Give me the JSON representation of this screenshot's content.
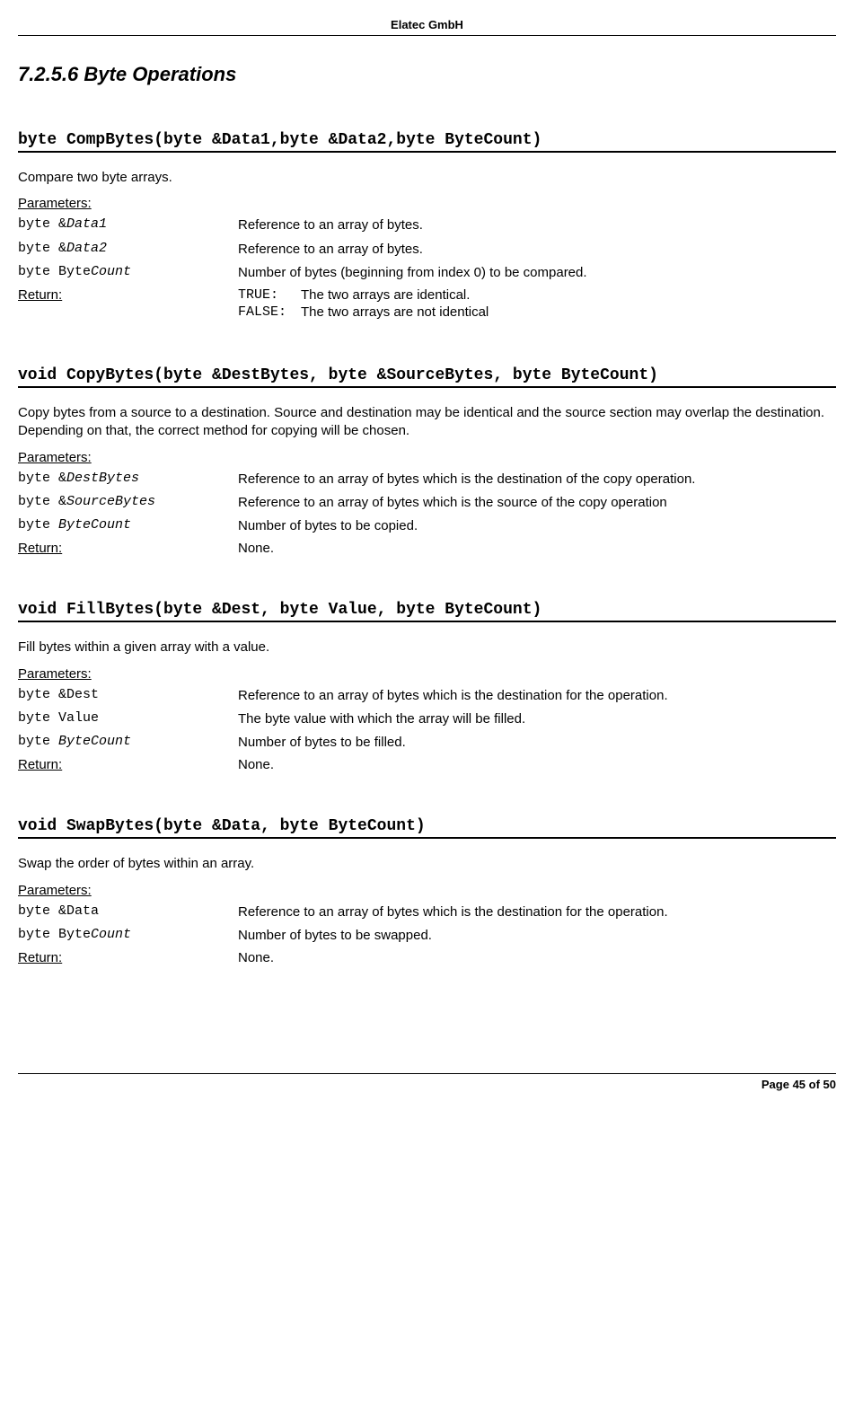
{
  "header": "Elatec GmbH",
  "section_title": "7.2.5.6  Byte Operations",
  "functions": [
    {
      "signature": "byte CompBytes(byte &Data1,byte &Data2,byte ByteCount)",
      "description": "Compare two byte arrays.",
      "params_label": "Parameters:",
      "params": [
        {
          "name_pre": "byte &",
          "name_ital": "Data1",
          "name_post": "",
          "desc": "Reference to an array of bytes."
        },
        {
          "name_pre": "byte &",
          "name_ital": "Data2",
          "name_post": "",
          "desc": "Reference to an array of bytes."
        },
        {
          "name_pre": "byte Byte",
          "name_ital": "Count",
          "name_post": "",
          "desc": "Number of bytes (beginning from index 0) to be compared."
        }
      ],
      "return_label": "Return:",
      "return_type": "codes",
      "return_codes": [
        {
          "code": "TRUE",
          "sep": ":",
          "text": "The two arrays are identical."
        },
        {
          "code": "FALSE",
          "sep": ":",
          "text": "The two arrays are not identical"
        }
      ]
    },
    {
      "signature": "void CopyBytes(byte &DestBytes, byte &SourceBytes, byte ByteCount)",
      "description": "Copy bytes from a source to a destination. Source and destination may be identical and the source section may overlap the destination. Depending on that, the correct method for copying will be chosen.",
      "params_label": "Parameters:",
      "params": [
        {
          "name_pre": "byte &",
          "name_ital": "DestBytes",
          "name_post": "",
          "desc": "Reference to an array of bytes which is the destination of the copy operation."
        },
        {
          "name_pre": "byte &",
          "name_ital": "SourceBytes",
          "name_post": "",
          "desc": "Reference to an array of bytes which is the source of the copy operation"
        },
        {
          "name_pre": "byte ",
          "name_ital": "ByteCount",
          "name_post": "",
          "desc": "Number of bytes to be copied."
        }
      ],
      "return_label": "Return:",
      "return_type": "text",
      "return_text": "None."
    },
    {
      "signature": "void FillBytes(byte &Dest, byte Value, byte ByteCount)",
      "description": "Fill bytes within a given array with a value.",
      "params_label": "Parameters:",
      "params": [
        {
          "name_pre": "byte &Dest",
          "name_ital": "",
          "name_post": "",
          "desc": "Reference to an array of bytes which is the destination for the operation."
        },
        {
          "name_pre": "byte Value",
          "name_ital": "",
          "name_post": "",
          "desc": "The byte value with which the array will be filled."
        },
        {
          "name_pre": "byte ",
          "name_ital": "ByteCount",
          "name_post": "",
          "desc": "Number of bytes to be filled."
        }
      ],
      "return_label": "Return:",
      "return_type": "text",
      "return_text": "None."
    },
    {
      "signature": "void SwapBytes(byte &Data, byte ByteCount)",
      "description": "Swap the order of bytes within an array.",
      "params_label": "Parameters:",
      "params": [
        {
          "name_pre": "byte &Data",
          "name_ital": "",
          "name_post": "",
          "desc": "Reference to an array of bytes which is the destination for the operation."
        },
        {
          "name_pre": "byte Byte",
          "name_ital": "Count",
          "name_post": "",
          "desc": "Number of bytes to be swapped."
        }
      ],
      "return_label": "Return:",
      "return_type": "text",
      "return_text": "None."
    }
  ],
  "footer": "Page 45 of 50"
}
